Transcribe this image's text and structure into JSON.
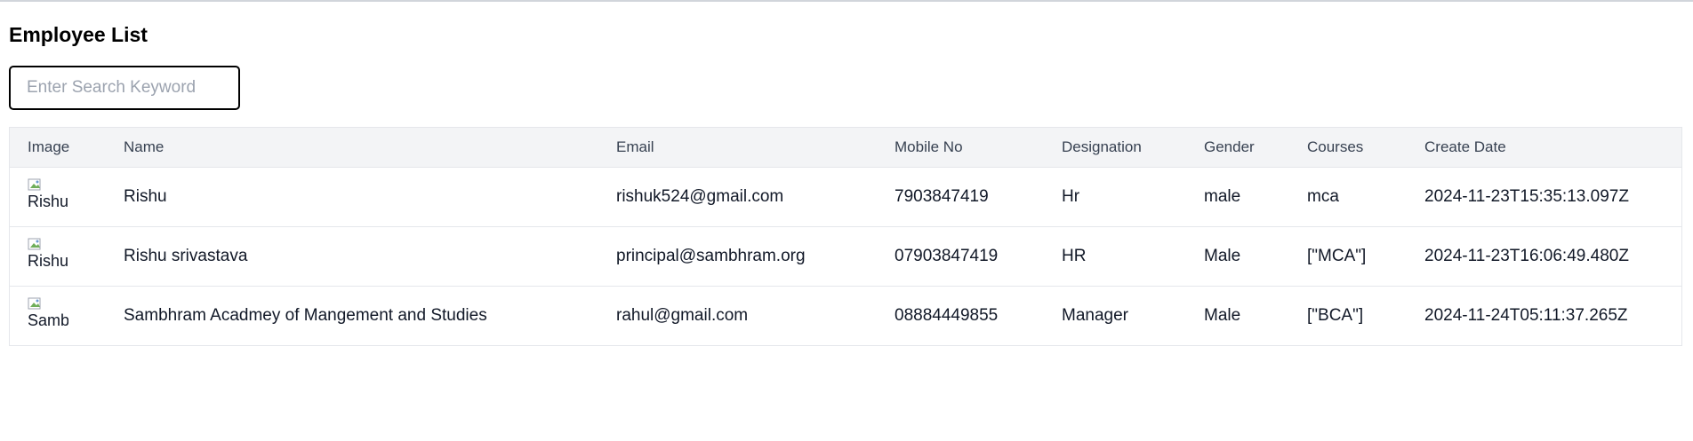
{
  "page": {
    "title": "Employee List"
  },
  "search": {
    "placeholder": "Enter Search Keyword",
    "value": ""
  },
  "table": {
    "headers": {
      "image": "Image",
      "name": "Name",
      "email": "Email",
      "mobile": "Mobile No",
      "designation": "Designation",
      "gender": "Gender",
      "courses": "Courses",
      "created": "Create Date"
    },
    "rows": [
      {
        "image_alt": "Rishu",
        "name": "Rishu",
        "email": "rishuk524@gmail.com",
        "mobile": "7903847419",
        "designation": "Hr",
        "gender": "male",
        "courses": "mca",
        "created": "2024-11-23T15:35:13.097Z"
      },
      {
        "image_alt": "Rishu",
        "name": "Rishu srivastava",
        "email": "principal@sambhram.org",
        "mobile": "07903847419",
        "designation": "HR",
        "gender": "Male",
        "courses": "[\"MCA\"]",
        "created": "2024-11-23T16:06:49.480Z"
      },
      {
        "image_alt": "Samb",
        "name": "Sambhram Acadmey of Mangement and Studies",
        "email": "rahul@gmail.com",
        "mobile": "08884449855",
        "designation": "Manager",
        "gender": "Male",
        "courses": "[\"BCA\"]",
        "created": "2024-11-24T05:11:37.265Z"
      }
    ]
  }
}
